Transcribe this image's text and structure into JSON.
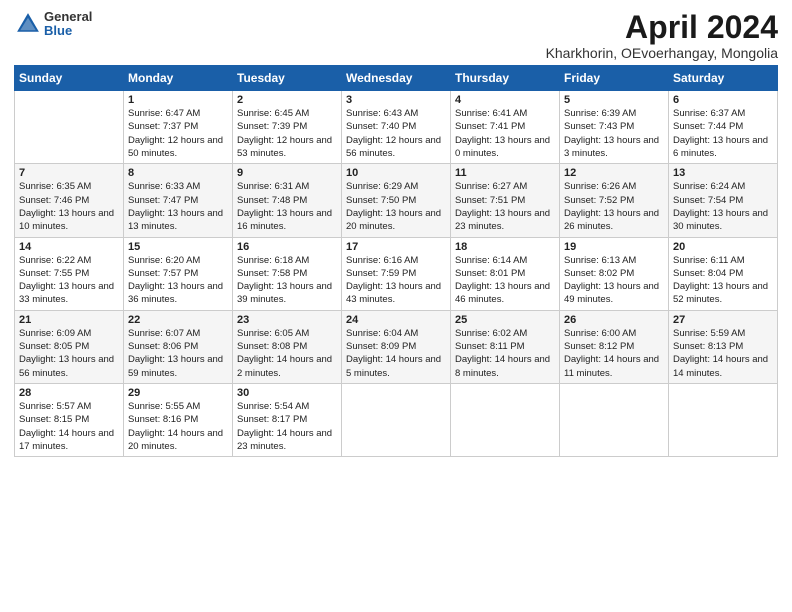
{
  "header": {
    "logo_general": "General",
    "logo_blue": "Blue",
    "title": "April 2024",
    "subtitle": "Kharkhorin, OEvoerhangay, Mongolia"
  },
  "days_of_week": [
    "Sunday",
    "Monday",
    "Tuesday",
    "Wednesday",
    "Thursday",
    "Friday",
    "Saturday"
  ],
  "weeks": [
    [
      {
        "day": "",
        "sunrise": "",
        "sunset": "",
        "daylight": ""
      },
      {
        "day": "1",
        "sunrise": "Sunrise: 6:47 AM",
        "sunset": "Sunset: 7:37 PM",
        "daylight": "Daylight: 12 hours and 50 minutes."
      },
      {
        "day": "2",
        "sunrise": "Sunrise: 6:45 AM",
        "sunset": "Sunset: 7:39 PM",
        "daylight": "Daylight: 12 hours and 53 minutes."
      },
      {
        "day": "3",
        "sunrise": "Sunrise: 6:43 AM",
        "sunset": "Sunset: 7:40 PM",
        "daylight": "Daylight: 12 hours and 56 minutes."
      },
      {
        "day": "4",
        "sunrise": "Sunrise: 6:41 AM",
        "sunset": "Sunset: 7:41 PM",
        "daylight": "Daylight: 13 hours and 0 minutes."
      },
      {
        "day": "5",
        "sunrise": "Sunrise: 6:39 AM",
        "sunset": "Sunset: 7:43 PM",
        "daylight": "Daylight: 13 hours and 3 minutes."
      },
      {
        "day": "6",
        "sunrise": "Sunrise: 6:37 AM",
        "sunset": "Sunset: 7:44 PM",
        "daylight": "Daylight: 13 hours and 6 minutes."
      }
    ],
    [
      {
        "day": "7",
        "sunrise": "Sunrise: 6:35 AM",
        "sunset": "Sunset: 7:46 PM",
        "daylight": "Daylight: 13 hours and 10 minutes."
      },
      {
        "day": "8",
        "sunrise": "Sunrise: 6:33 AM",
        "sunset": "Sunset: 7:47 PM",
        "daylight": "Daylight: 13 hours and 13 minutes."
      },
      {
        "day": "9",
        "sunrise": "Sunrise: 6:31 AM",
        "sunset": "Sunset: 7:48 PM",
        "daylight": "Daylight: 13 hours and 16 minutes."
      },
      {
        "day": "10",
        "sunrise": "Sunrise: 6:29 AM",
        "sunset": "Sunset: 7:50 PM",
        "daylight": "Daylight: 13 hours and 20 minutes."
      },
      {
        "day": "11",
        "sunrise": "Sunrise: 6:27 AM",
        "sunset": "Sunset: 7:51 PM",
        "daylight": "Daylight: 13 hours and 23 minutes."
      },
      {
        "day": "12",
        "sunrise": "Sunrise: 6:26 AM",
        "sunset": "Sunset: 7:52 PM",
        "daylight": "Daylight: 13 hours and 26 minutes."
      },
      {
        "day": "13",
        "sunrise": "Sunrise: 6:24 AM",
        "sunset": "Sunset: 7:54 PM",
        "daylight": "Daylight: 13 hours and 30 minutes."
      }
    ],
    [
      {
        "day": "14",
        "sunrise": "Sunrise: 6:22 AM",
        "sunset": "Sunset: 7:55 PM",
        "daylight": "Daylight: 13 hours and 33 minutes."
      },
      {
        "day": "15",
        "sunrise": "Sunrise: 6:20 AM",
        "sunset": "Sunset: 7:57 PM",
        "daylight": "Daylight: 13 hours and 36 minutes."
      },
      {
        "day": "16",
        "sunrise": "Sunrise: 6:18 AM",
        "sunset": "Sunset: 7:58 PM",
        "daylight": "Daylight: 13 hours and 39 minutes."
      },
      {
        "day": "17",
        "sunrise": "Sunrise: 6:16 AM",
        "sunset": "Sunset: 7:59 PM",
        "daylight": "Daylight: 13 hours and 43 minutes."
      },
      {
        "day": "18",
        "sunrise": "Sunrise: 6:14 AM",
        "sunset": "Sunset: 8:01 PM",
        "daylight": "Daylight: 13 hours and 46 minutes."
      },
      {
        "day": "19",
        "sunrise": "Sunrise: 6:13 AM",
        "sunset": "Sunset: 8:02 PM",
        "daylight": "Daylight: 13 hours and 49 minutes."
      },
      {
        "day": "20",
        "sunrise": "Sunrise: 6:11 AM",
        "sunset": "Sunset: 8:04 PM",
        "daylight": "Daylight: 13 hours and 52 minutes."
      }
    ],
    [
      {
        "day": "21",
        "sunrise": "Sunrise: 6:09 AM",
        "sunset": "Sunset: 8:05 PM",
        "daylight": "Daylight: 13 hours and 56 minutes."
      },
      {
        "day": "22",
        "sunrise": "Sunrise: 6:07 AM",
        "sunset": "Sunset: 8:06 PM",
        "daylight": "Daylight: 13 hours and 59 minutes."
      },
      {
        "day": "23",
        "sunrise": "Sunrise: 6:05 AM",
        "sunset": "Sunset: 8:08 PM",
        "daylight": "Daylight: 14 hours and 2 minutes."
      },
      {
        "day": "24",
        "sunrise": "Sunrise: 6:04 AM",
        "sunset": "Sunset: 8:09 PM",
        "daylight": "Daylight: 14 hours and 5 minutes."
      },
      {
        "day": "25",
        "sunrise": "Sunrise: 6:02 AM",
        "sunset": "Sunset: 8:11 PM",
        "daylight": "Daylight: 14 hours and 8 minutes."
      },
      {
        "day": "26",
        "sunrise": "Sunrise: 6:00 AM",
        "sunset": "Sunset: 8:12 PM",
        "daylight": "Daylight: 14 hours and 11 minutes."
      },
      {
        "day": "27",
        "sunrise": "Sunrise: 5:59 AM",
        "sunset": "Sunset: 8:13 PM",
        "daylight": "Daylight: 14 hours and 14 minutes."
      }
    ],
    [
      {
        "day": "28",
        "sunrise": "Sunrise: 5:57 AM",
        "sunset": "Sunset: 8:15 PM",
        "daylight": "Daylight: 14 hours and 17 minutes."
      },
      {
        "day": "29",
        "sunrise": "Sunrise: 5:55 AM",
        "sunset": "Sunset: 8:16 PM",
        "daylight": "Daylight: 14 hours and 20 minutes."
      },
      {
        "day": "30",
        "sunrise": "Sunrise: 5:54 AM",
        "sunset": "Sunset: 8:17 PM",
        "daylight": "Daylight: 14 hours and 23 minutes."
      },
      {
        "day": "",
        "sunrise": "",
        "sunset": "",
        "daylight": ""
      },
      {
        "day": "",
        "sunrise": "",
        "sunset": "",
        "daylight": ""
      },
      {
        "day": "",
        "sunrise": "",
        "sunset": "",
        "daylight": ""
      },
      {
        "day": "",
        "sunrise": "",
        "sunset": "",
        "daylight": ""
      }
    ]
  ]
}
